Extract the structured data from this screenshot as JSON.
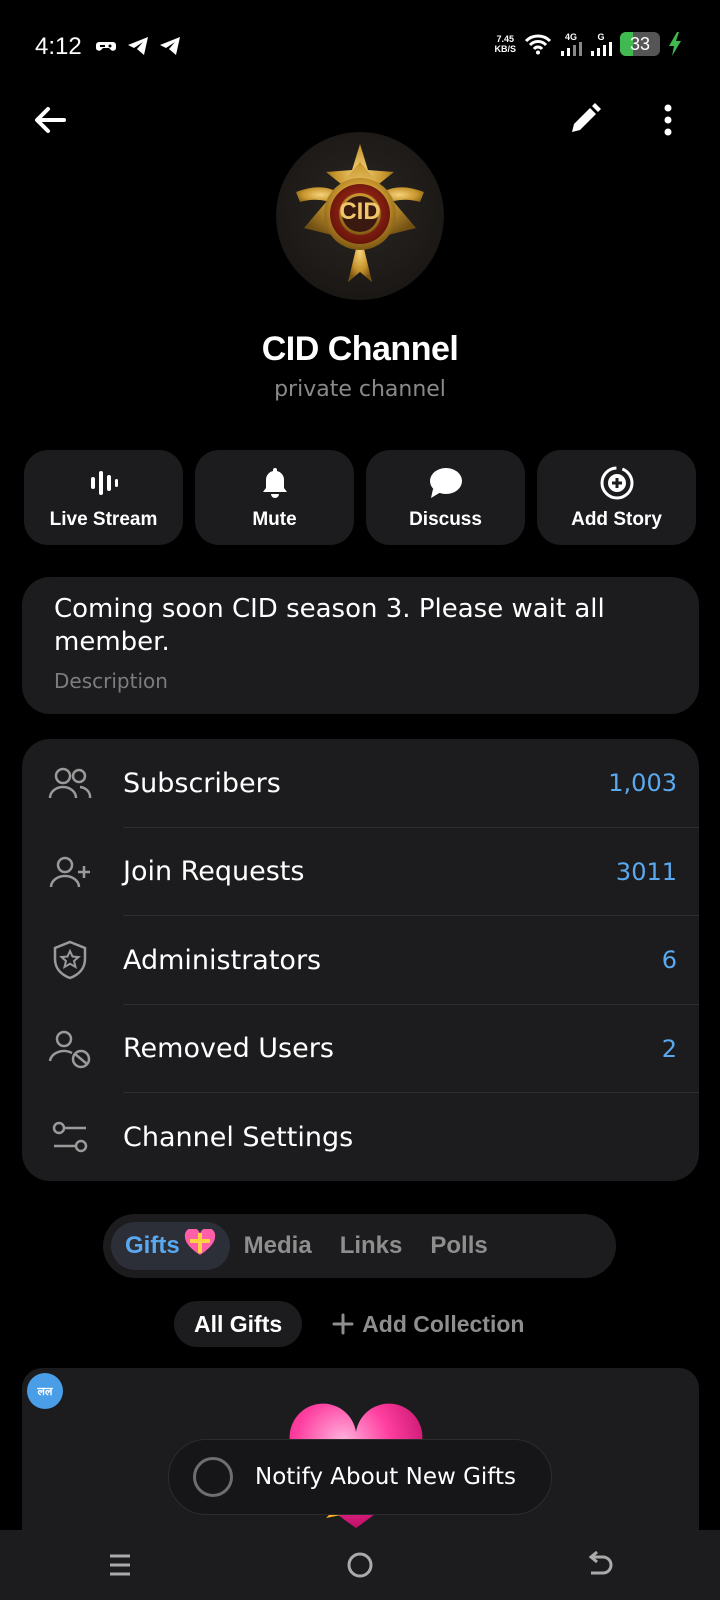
{
  "status_bar": {
    "time": "4:12",
    "net_speed_value": "7.45",
    "net_speed_unit": "KB/S",
    "network_4g": "4G",
    "network_g": "G",
    "battery_level": "33",
    "battery_fraction": 0.33,
    "left_icons": [
      "gamepad-icon",
      "telegram-icon",
      "telegram-icon"
    ],
    "right_icons": [
      "wifi-icon",
      "signal-icon",
      "signal-icon",
      "battery-icon",
      "charging-icon"
    ]
  },
  "top_bar": {
    "icons": [
      "back-arrow-icon",
      "edit-pencil-icon",
      "more-vertical-icon"
    ]
  },
  "channel": {
    "title": "CID Channel",
    "subtitle": "private channel",
    "avatar_text": "CID"
  },
  "actions": [
    {
      "label": "Live Stream",
      "icon": "live-stream-icon"
    },
    {
      "label": "Mute",
      "icon": "bell-icon"
    },
    {
      "label": "Discuss",
      "icon": "chat-bubble-icon"
    },
    {
      "label": "Add Story",
      "icon": "add-story-icon"
    }
  ],
  "description": {
    "text": "Coming soon  CID season 3. Please wait all member.",
    "label": "Description"
  },
  "rows": [
    {
      "label": "Subscribers",
      "value": "1,003",
      "icon": "users-icon"
    },
    {
      "label": "Join Requests",
      "value": "3011",
      "icon": "user-plus-icon"
    },
    {
      "label": "Administrators",
      "value": "6",
      "icon": "shield-star-icon"
    },
    {
      "label": "Removed Users",
      "value": "2",
      "icon": "user-blocked-icon"
    },
    {
      "label": "Channel Settings",
      "value": "",
      "icon": "sliders-icon"
    }
  ],
  "tabs": [
    {
      "label": "Gifts",
      "active": true
    },
    {
      "label": "Media",
      "active": false
    },
    {
      "label": "Links",
      "active": false
    },
    {
      "label": "Polls",
      "active": false
    }
  ],
  "subfilters": {
    "all_gifts": "All Gifts",
    "add_collection": "Add Collection"
  },
  "gift_card": {
    "badge_text": "लल"
  },
  "notify": {
    "label": "Notify About New Gifts"
  },
  "colors": {
    "accent": "#5aa9f0",
    "card_bg": "#1c1c1e",
    "background": "#000000"
  }
}
